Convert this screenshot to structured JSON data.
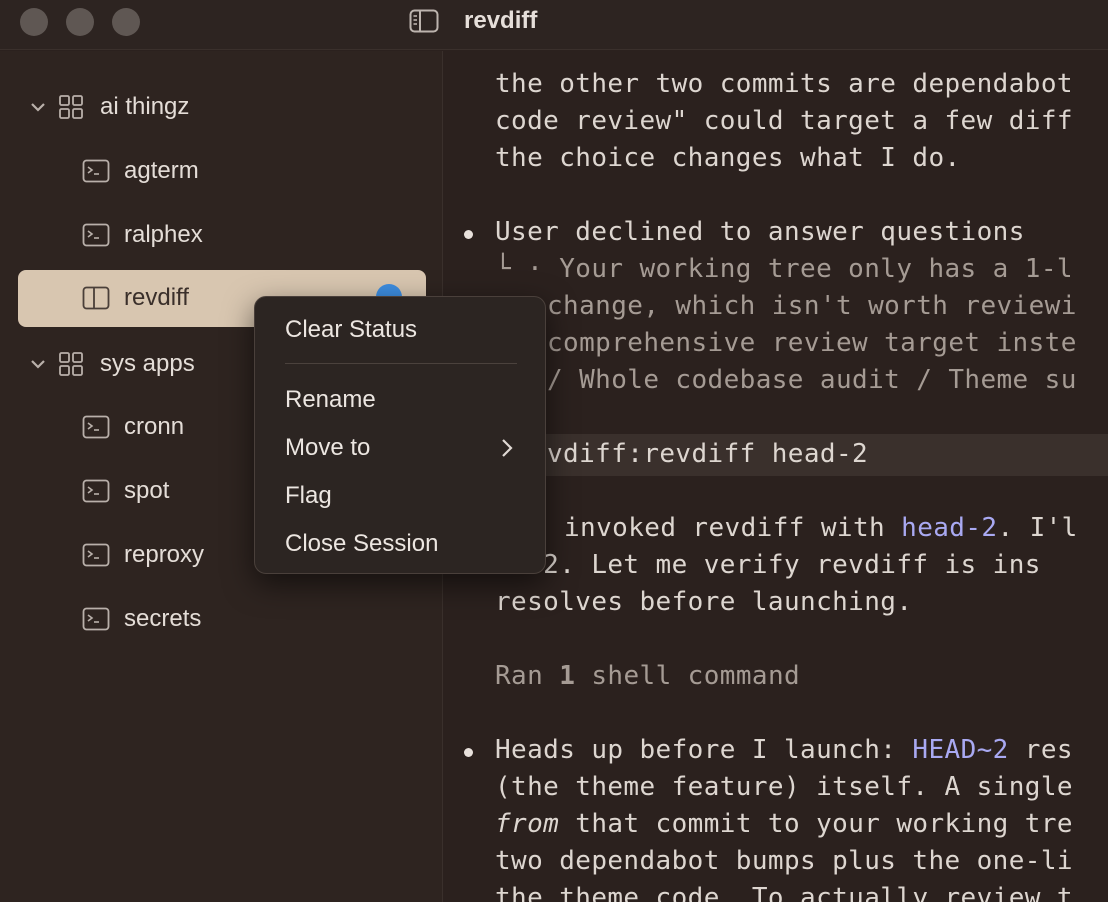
{
  "window": {
    "title": "revdiff"
  },
  "sidebar": {
    "groups": [
      {
        "label": "ai thingz",
        "items": [
          {
            "label": "agterm"
          },
          {
            "label": "ralphex"
          },
          {
            "label": "revdiff"
          }
        ]
      },
      {
        "label": "sys apps",
        "items": [
          {
            "label": "cronn"
          },
          {
            "label": "spot"
          },
          {
            "label": "reproxy"
          },
          {
            "label": "secrets"
          }
        ]
      }
    ],
    "selected": "revdiff",
    "status_dot_color": "#3d8de0"
  },
  "content": {
    "lines": [
      "the other two commits are dependabot",
      "code review\" could target a few diff",
      "the choice changes what I do.",
      "User declined to answer questions",
      "└  · Your working tree only has a 1-l",
      "change, which isn't worth reviewi",
      "comprehensive review target inste",
      "/ Whole codebase audit / Theme su",
      "vdiff:revdiff head-2",
      "invoked revdiff with",
      "head-2",
      ". I'l",
      "AD~2. Let me verify revdiff is ins",
      "resolves before launching.",
      "Ran",
      "1",
      "shell command",
      "Heads up before I launch:",
      "HEAD~2",
      "res",
      "(the theme feature) itself. A single",
      "from",
      "that commit to your working tre",
      "two dependabot bumps plus the one-li",
      "the theme code. To actually review t"
    ]
  },
  "context_menu": {
    "items": [
      "Clear Status",
      "Rename",
      "Move to",
      "Flag",
      "Close Session"
    ]
  },
  "colors": {
    "accent_text": "#a9a9f2",
    "selection_bg": "#d8c6b0"
  }
}
